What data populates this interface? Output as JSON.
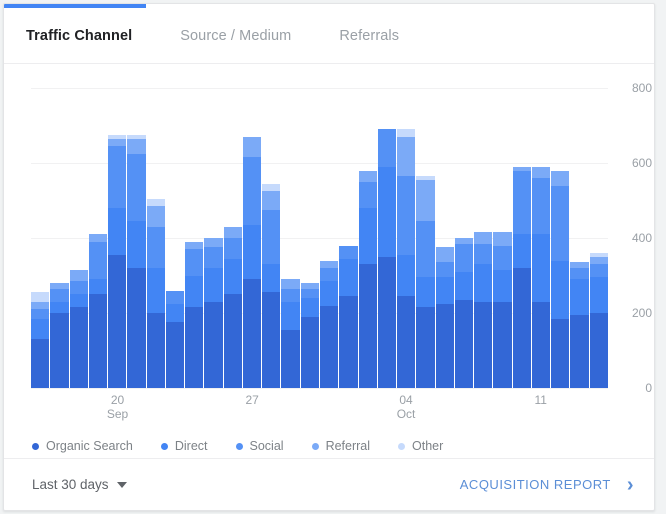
{
  "accent_color": "#4285f4",
  "tabs": [
    {
      "label": "Traffic Channel",
      "active": true
    },
    {
      "label": "Source / Medium",
      "active": false
    },
    {
      "label": "Referrals",
      "active": false
    }
  ],
  "footer": {
    "date_range": "Last 30 days",
    "caret_icon": "chevron-down-icon",
    "report_link": "ACQUISITION REPORT",
    "chevron_icon": "chevron-right-icon"
  },
  "chart_data": {
    "type": "bar",
    "stacked": true,
    "title": "",
    "xlabel": "",
    "ylabel": "",
    "ylim": [
      0,
      800
    ],
    "yticks": [
      0,
      200,
      400,
      600,
      800
    ],
    "grid": true,
    "legend_position": "bottom",
    "colors": {
      "Organic Search": "#3367d6",
      "Direct": "#4285f4",
      "Social": "#5491f5",
      "Referral": "#7baaf7",
      "Other": "#c6dafc"
    },
    "categories": [
      "16 Sep",
      "17 Sep",
      "18 Sep",
      "19 Sep",
      "20 Sep",
      "21 Sep",
      "22 Sep",
      "23 Sep",
      "24 Sep",
      "25 Sep",
      "26 Sep",
      "27 Sep",
      "28 Sep",
      "29 Sep",
      "30 Sep",
      "01 Oct",
      "02 Oct",
      "03 Oct",
      "04 Oct",
      "05 Oct",
      "06 Oct",
      "07 Oct",
      "08 Oct",
      "09 Oct",
      "10 Oct",
      "11 Oct",
      "12 Oct",
      "13 Oct",
      "14 Oct",
      "15 Oct"
    ],
    "xtick_labels": [
      {
        "index": 4,
        "label": "20",
        "sub": "Sep"
      },
      {
        "index": 11,
        "label": "27",
        "sub": ""
      },
      {
        "index": 19,
        "label": "04",
        "sub": "Oct"
      },
      {
        "index": 26,
        "label": "11",
        "sub": ""
      }
    ],
    "series": [
      {
        "name": "Organic Search",
        "values": [
          130,
          200,
          215,
          250,
          355,
          320,
          200,
          175,
          215,
          230,
          250,
          290,
          255,
          155,
          190,
          220,
          245,
          330,
          350,
          245,
          215,
          225,
          235,
          230,
          230,
          320,
          230,
          185,
          195,
          200
        ]
      },
      {
        "name": "Direct",
        "values": [
          55,
          30,
          35,
          40,
          125,
          125,
          120,
          50,
          85,
          90,
          95,
          145,
          75,
          75,
          50,
          65,
          100,
          150,
          240,
          110,
          80,
          70,
          75,
          100,
          85,
          90,
          180,
          155,
          95,
          95
        ]
      },
      {
        "name": "Social",
        "values": [
          25,
          35,
          35,
          100,
          165,
          180,
          110,
          35,
          70,
          55,
          55,
          180,
          145,
          35,
          25,
          35,
          35,
          70,
          100,
          210,
          150,
          40,
          75,
          55,
          65,
          170,
          150,
          200,
          30,
          35
        ]
      },
      {
        "name": "Referral",
        "values": [
          20,
          15,
          30,
          20,
          20,
          40,
          55,
          0,
          20,
          25,
          30,
          55,
          50,
          25,
          15,
          20,
          0,
          30,
          0,
          105,
          110,
          40,
          15,
          30,
          35,
          10,
          30,
          40,
          15,
          20
        ]
      },
      {
        "name": "Other",
        "values": [
          25,
          0,
          0,
          0,
          10,
          10,
          20,
          0,
          0,
          0,
          0,
          0,
          20,
          0,
          0,
          0,
          0,
          0,
          0,
          20,
          10,
          0,
          0,
          0,
          0,
          0,
          0,
          0,
          0,
          10
        ]
      }
    ]
  }
}
